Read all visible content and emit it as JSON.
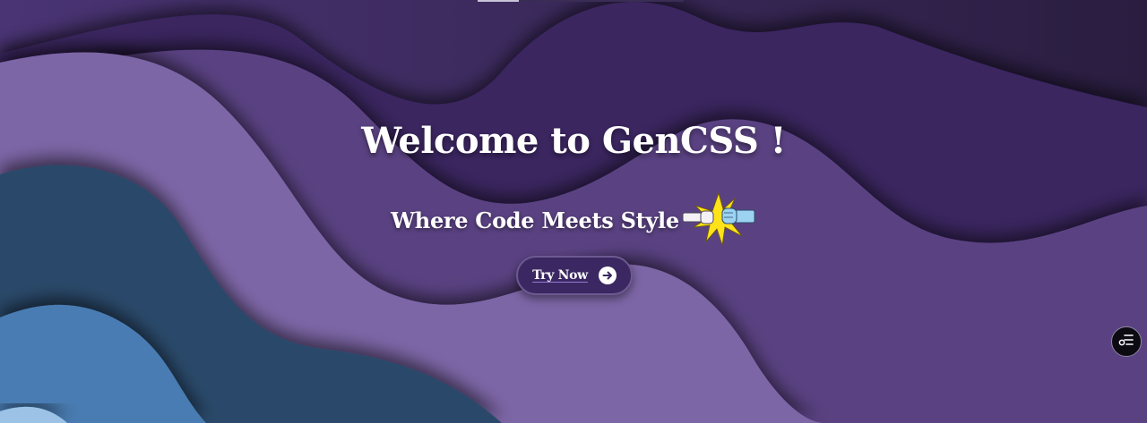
{
  "hero": {
    "title": "Welcome to GenCSS !",
    "subtitle": "Where Code Meets Style",
    "subtitle_emoji": "fist-bump-icon"
  },
  "cta": {
    "label": "Try Now",
    "icon": "arrow-right-circle-icon"
  },
  "floating_action": {
    "icon": "filter-settings-icon"
  },
  "colors": {
    "wave_dark_purple": "#3a2561",
    "wave_mid_purple": "#5a4282",
    "wave_light_purple": "#7d66a6",
    "wave_navy": "#2c4a6a",
    "wave_blue": "#4a7cb2",
    "wave_light_blue": "#9cc3e6",
    "button_bg": "#3b2761",
    "text": "#ffffff"
  }
}
